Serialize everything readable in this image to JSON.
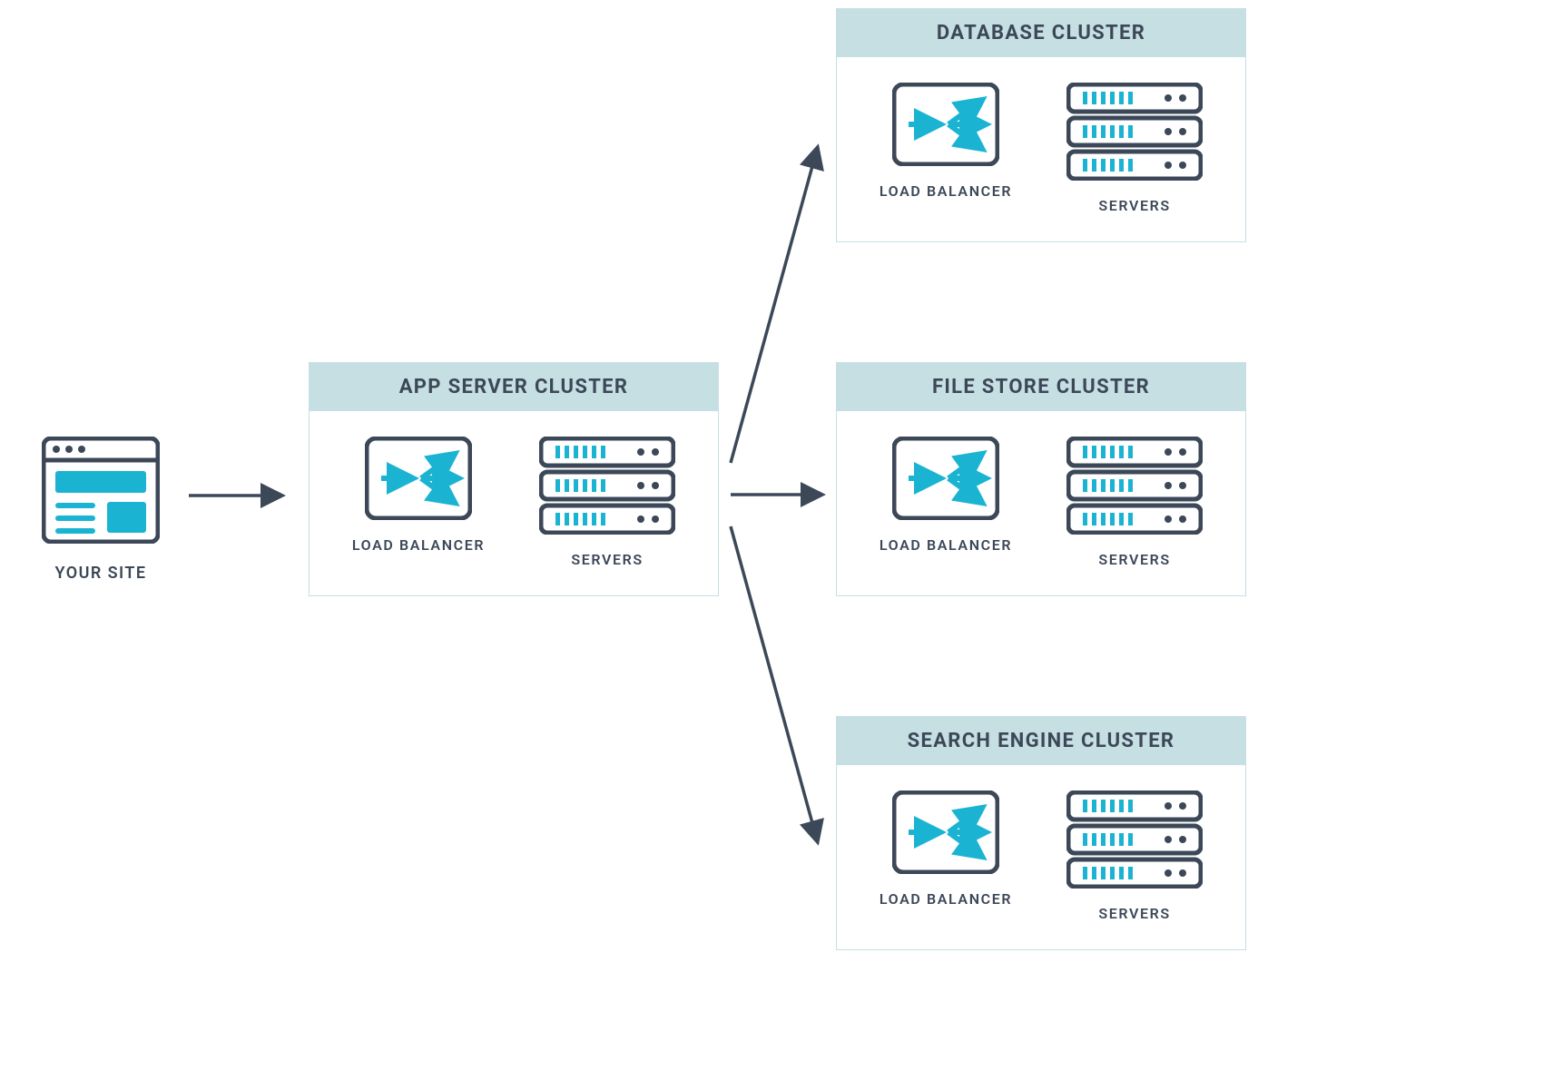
{
  "source": {
    "label": "YOUR SITE"
  },
  "app_cluster": {
    "title": "APP SERVER CLUSTER",
    "lb_label": "LOAD BALANCER",
    "srv_label": "SERVERS"
  },
  "right_clusters": [
    {
      "title": "DATABASE CLUSTER",
      "lb_label": "LOAD BALANCER",
      "srv_label": "SERVERS"
    },
    {
      "title": "FILE STORE CLUSTER",
      "lb_label": "LOAD BALANCER",
      "srv_label": "SERVERS"
    },
    {
      "title": "SEARCH ENGINE CLUSTER",
      "lb_label": "LOAD BALANCER",
      "srv_label": "SERVERS"
    }
  ],
  "colors": {
    "dark": "#3c4858",
    "cyan": "#1ab4d2",
    "header": "#c6dfe3"
  }
}
